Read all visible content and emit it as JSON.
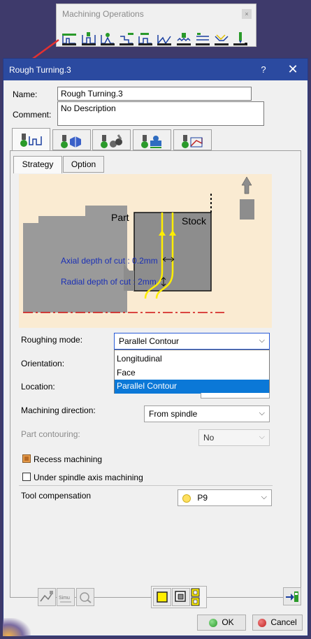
{
  "toolbar": {
    "title": "Machining Operations",
    "close_glyph": "×",
    "icons": [
      "rough-turning-icon",
      "groove-turning-icon",
      "recess-turning-icon",
      "profile-finish-icon",
      "groove-finish-icon",
      "ramp-rough-icon",
      "thread-turning-icon",
      "sequential-turning-icon",
      "ramp-recess-icon",
      "turning-drill-icon"
    ]
  },
  "dialog": {
    "title": "Rough Turning.3",
    "help_glyph": "?",
    "close_glyph": "✕",
    "name_label": "Name:",
    "name_value": "Rough Turning.3",
    "comment_label": "Comment:",
    "comment_value": "No Description",
    "tabs": [
      "strategy-parameters-tab",
      "geometry-tab",
      "tool-tab",
      "feeds-speeds-tab",
      "macros-tab"
    ],
    "subtabs": [
      "Strategy",
      "Option"
    ],
    "diagram": {
      "part": "Part",
      "stock": "Stock",
      "axial": "Axial depth of cut : 0.2mm",
      "radial": "Radial depth of cut : 2mm"
    },
    "roughing_mode_label": "Roughing mode:",
    "roughing_mode_value": "Parallel Contour",
    "roughing_mode_options": [
      "Longitudinal",
      "Face",
      "Parallel Contour"
    ],
    "orientation_label": "Orientation:",
    "location_label": "Location:",
    "machining_direction_label": "Machining direction:",
    "machining_direction_value": "From spindle",
    "part_contouring_label": "Part contouring:",
    "part_contouring_value": "No",
    "recess_label": "Recess machining",
    "under_spindle_label": "Under spindle axis machining",
    "tool_comp_label": "Tool compensation",
    "tool_comp_value": "P9",
    "ok_label": "OK",
    "cancel_label": "Cancel",
    "bottom_icons": [
      "tool-path-replay-icon",
      "simulation-icon",
      "analyze-icon",
      "yellow-square-icon",
      "preview-icon",
      "display-options-icon",
      "export-icon"
    ]
  },
  "colors": {
    "titlebar": "#2b4aa0",
    "diagram_bg": "#faebd2",
    "part_gray": "#9a9a9a",
    "path_yellow": "#ffee00",
    "text_blue": "#1a2fb5",
    "selection": "#0b78d7",
    "ok_green": "#2a9a2a",
    "cancel_red": "#c02020",
    "tool_dot": "#ffe060"
  }
}
